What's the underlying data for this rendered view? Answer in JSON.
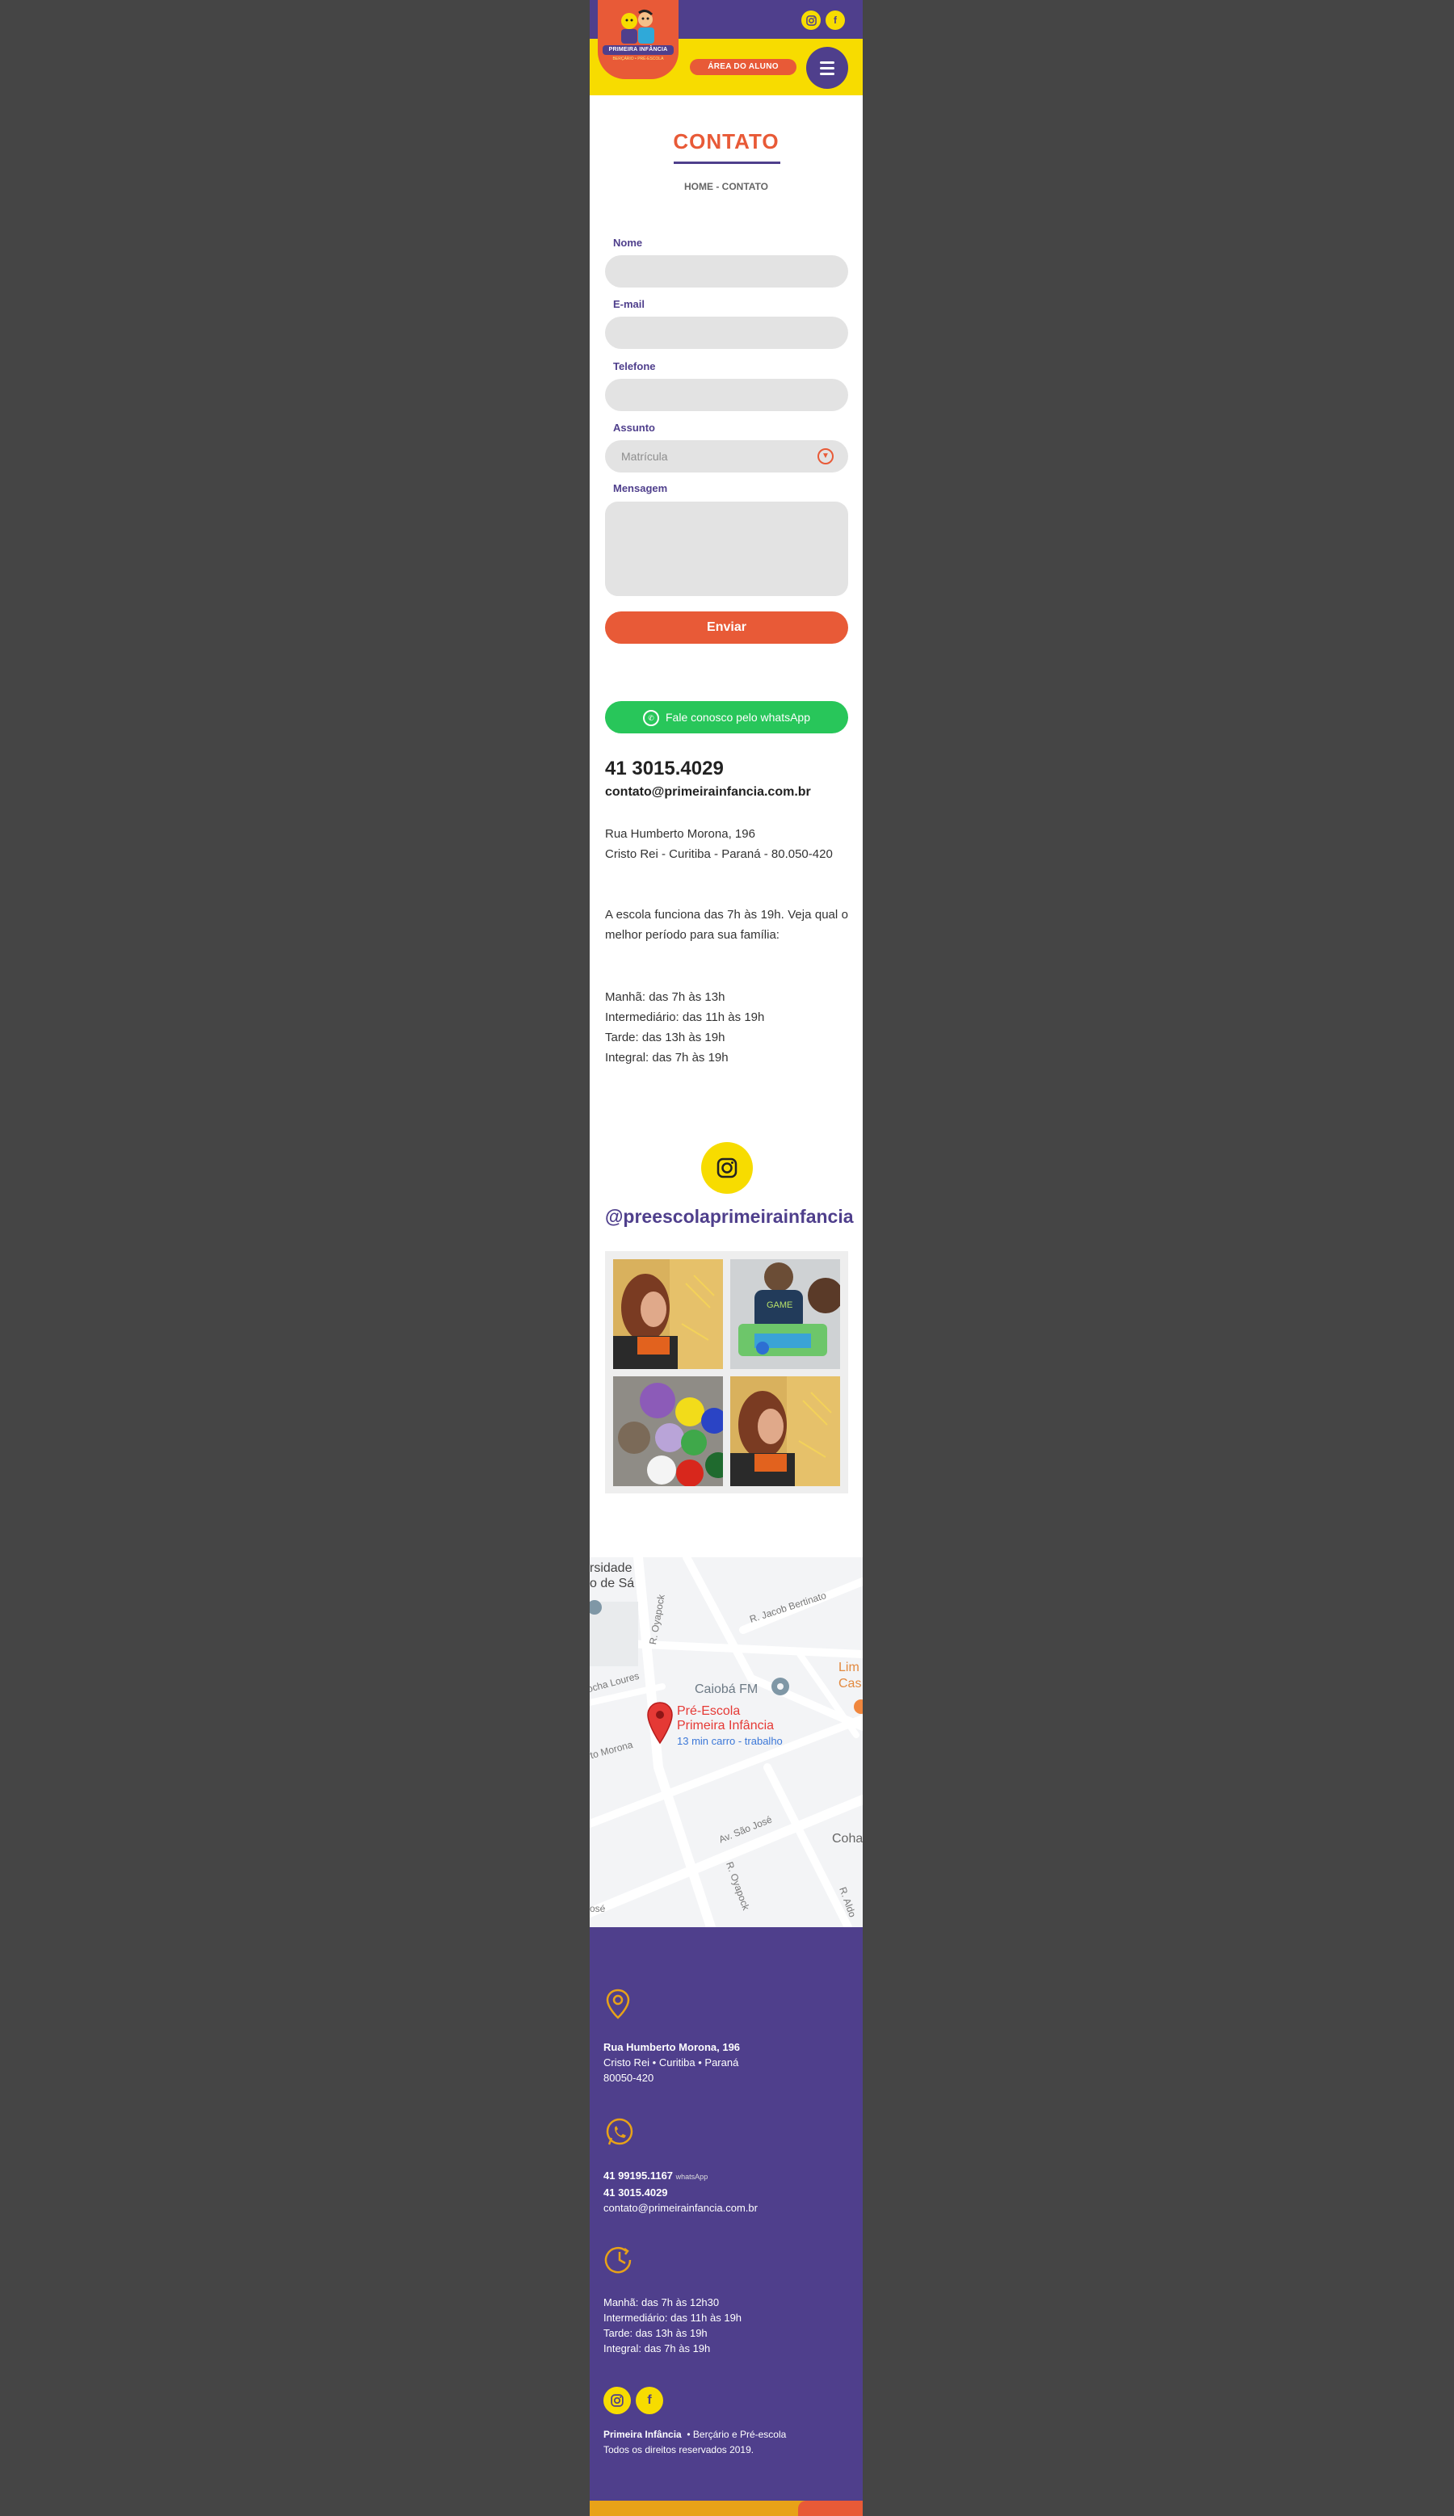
{
  "header": {
    "logo_name": "PRIMEIRA INFÂNCIA",
    "logo_sub": "BERÇÁRIO • PRÉ-ESCOLA",
    "area_button": "ÁREA DO ALUNO",
    "social": [
      "instagram-icon",
      "facebook-icon"
    ]
  },
  "page": {
    "title": "CONTATO",
    "breadcrumb": "HOME - CONTATO"
  },
  "form": {
    "nome_label": "Nome",
    "email_label": "E-mail",
    "telefone_label": "Telefone",
    "assunto_label": "Assunto",
    "assunto_value": "Matrícula",
    "mensagem_label": "Mensagem",
    "submit_label": "Enviar"
  },
  "whatsapp_button": "Fale conosco pelo whatsApp",
  "contact": {
    "phone": "41 3015.4029",
    "email": "contato@primeirainfancia.com.br",
    "address_line1": "Rua Humberto Morona, 196",
    "address_line2": "Cristo Rei - Curitiba - Paraná - 80.050-420",
    "hours_intro": "A escola funciona das 7h às 19h. Veja qual o melhor período para sua família:",
    "hours": [
      "Manhã: das 7h às 13h",
      "Intermediário: das 11h às 19h",
      "Tarde: das 13h às 19h",
      "Integral: das 7h às 19h"
    ]
  },
  "instagram": {
    "handle": "@preescolaprimeirainfancia"
  },
  "map": {
    "place_name_1": "Pré-Escola",
    "place_name_2": "Primeira Infância",
    "travel": "13 min carro - trabalho",
    "labels": [
      "rsidade",
      "o de Sá",
      "R. Jacob Bertinato",
      "Caiobá FM",
      "Lim",
      "Cas",
      "ocha Loures",
      "R. Oyapock",
      "rto Morona",
      "Av. São José",
      "Coha",
      "R. Oyapock",
      "R. Aldo",
      "osé"
    ]
  },
  "footer": {
    "address_bold": "Rua Humberto Morona, 196",
    "address_line2": "Cristo Rei  •  Curitiba  •  Paraná",
    "address_line3": "80050-420",
    "whatsapp_number": "41 99195.1167",
    "whatsapp_tag": "whatsApp",
    "phone": "41 3015.4029",
    "email": "contato@primeirainfancia.com.br",
    "hours": [
      "Manhã: das 7h às 12h30",
      "Intermediário: das 11h às 19h",
      "Tarde: das 13h às 19h",
      "Integral: das 7h às 19h"
    ],
    "brand": "Primeira Infância",
    "brand_desc": "•  Berçário e Pré-escola",
    "copyright": "Todos os direitos reservados 2019."
  },
  "colors": {
    "purple": "#4f3f8c",
    "yellow": "#f7dc00",
    "orange": "#e85a37",
    "green": "#28c65a"
  }
}
